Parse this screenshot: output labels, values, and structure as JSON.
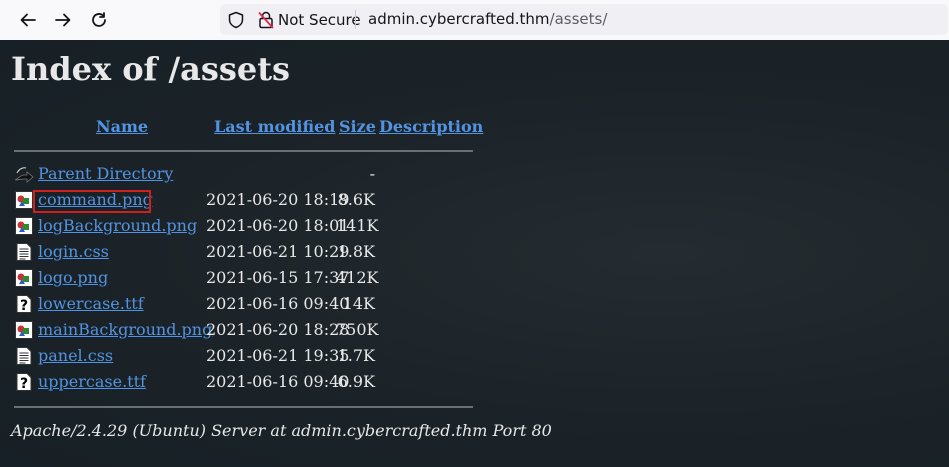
{
  "browser": {
    "security_label": "Not Secure",
    "url_host": "admin.cybercrafted.thm",
    "url_path": "/assets/"
  },
  "page": {
    "title": "Index of /assets",
    "columns": {
      "name": "Name",
      "last_modified": "Last modified",
      "size": "Size",
      "description": "Description"
    },
    "parent": {
      "name": "Parent Directory",
      "size": "-"
    },
    "files": [
      {
        "name": "command.png",
        "modified": "2021-06-20 18:19",
        "size": "8.6K",
        "type": "image"
      },
      {
        "name": "logBackground.png",
        "modified": "2021-06-20 18:01",
        "size": "141K",
        "type": "image"
      },
      {
        "name": "login.css",
        "modified": "2021-06-21 10:29",
        "size": "1.8K",
        "type": "text"
      },
      {
        "name": "logo.png",
        "modified": "2021-06-15 17:37",
        "size": "412K",
        "type": "image"
      },
      {
        "name": "lowercase.ttf",
        "modified": "2021-06-16 09:40",
        "size": "14K",
        "type": "unknown"
      },
      {
        "name": "mainBackground.png",
        "modified": "2021-06-20 18:28",
        "size": "750K",
        "type": "image"
      },
      {
        "name": "panel.css",
        "modified": "2021-06-21 19:35",
        "size": "1.7K",
        "type": "text"
      },
      {
        "name": "uppercase.ttf",
        "modified": "2021-06-16 09:40",
        "size": "6.9K",
        "type": "unknown"
      }
    ],
    "footer": "Apache/2.4.29 (Ubuntu) Server at admin.cybercrafted.thm Port 80"
  },
  "colors": {
    "link": "#5294e2",
    "background": "#1b2328",
    "text": "#e8e8e8",
    "highlight": "#d0201e"
  }
}
